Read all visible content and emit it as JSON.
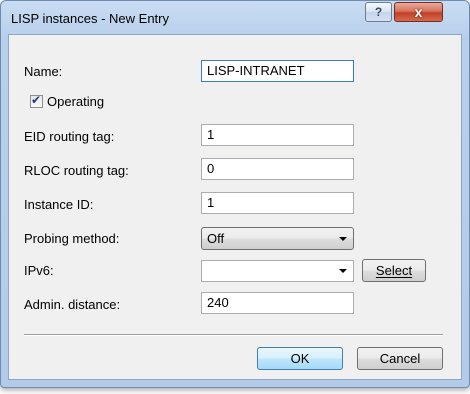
{
  "window": {
    "title": "LISP instances - New Entry",
    "help_label": "?",
    "close_label": "x"
  },
  "form": {
    "name": {
      "label": "Name:",
      "value": "LISP-INTRANET"
    },
    "operating": {
      "label": "Operating",
      "checked": true
    },
    "eid_routing_tag": {
      "label": "EID routing tag:",
      "value": "1"
    },
    "rloc_routing_tag": {
      "label": "RLOC routing tag:",
      "value": "0"
    },
    "instance_id": {
      "label": "Instance ID:",
      "value": "1"
    },
    "probing_method": {
      "label": "Probing method:",
      "value": "Off"
    },
    "ipv6": {
      "label": "IPv6:",
      "value": "",
      "select_label": "Select"
    },
    "admin_distance": {
      "label": "Admin. distance:",
      "value": "240"
    }
  },
  "buttons": {
    "ok": "OK",
    "cancel": "Cancel"
  },
  "icons": {
    "checkmark": "check-icon",
    "dropdown": "chevron-down-icon"
  }
}
